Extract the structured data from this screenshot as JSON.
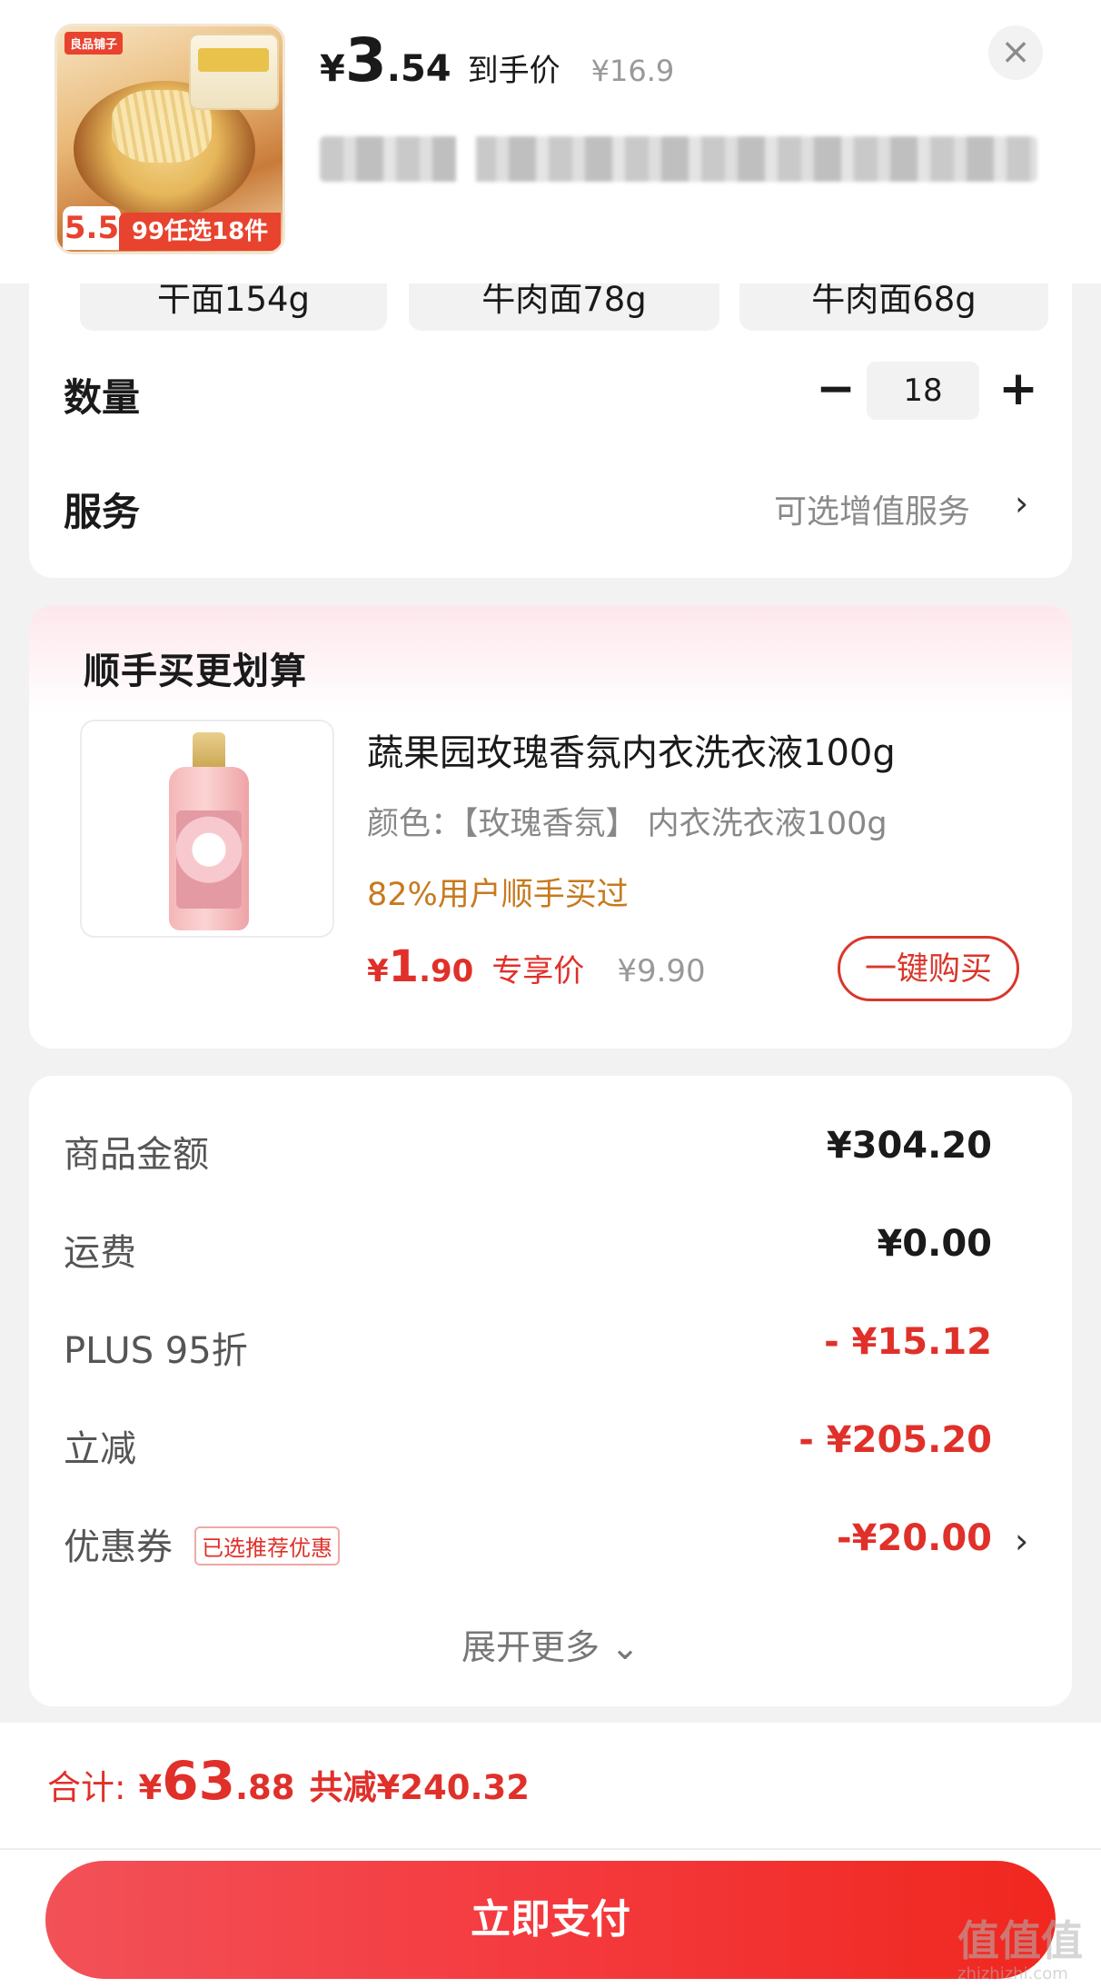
{
  "header": {
    "product_image": {
      "brand_logo": "良品铺子",
      "badge_number": "5.5",
      "promo_tag": "99任选18件"
    },
    "price": {
      "currency": "¥",
      "integer": "3",
      "decimal": ".54",
      "label": "到手价",
      "original": "¥16.9"
    }
  },
  "spec_options": [
    "干面154g",
    "牛肉面78g",
    "牛肉面68g"
  ],
  "quantity": {
    "label": "数量",
    "value": "18",
    "minus": "−",
    "plus": "+"
  },
  "service": {
    "label": "服务",
    "value": "可选增值服务",
    "chevron": "›"
  },
  "addon": {
    "section_title": "顺手买更划算",
    "name": "蔬果园玫瑰香氛内衣洗衣液100g",
    "spec": "颜色：【玫瑰香氛】 内衣洗衣液100g",
    "stat": "82%用户顺手买过",
    "price": {
      "currency": "¥",
      "integer": "1",
      "decimal": ".90",
      "label": "专享价",
      "original": "¥9.90"
    },
    "buy_button": "一键购买"
  },
  "summary": {
    "rows": [
      {
        "label": "商品金额",
        "value": "¥304.20"
      },
      {
        "label": "运费",
        "value": "¥0.00"
      },
      {
        "label": "PLUS 95折",
        "value": "- ¥15.12"
      },
      {
        "label": "立减",
        "value": "- ¥205.20"
      },
      {
        "label": "优惠券",
        "value": "-¥20.00"
      }
    ],
    "coupon_tag": "已选推荐优惠",
    "expand": "展开更多 ⌄"
  },
  "footer": {
    "total_label": "合计:",
    "currency": "¥",
    "total_integer": "63",
    "total_decimal": ".88",
    "saved": "共减¥240.32",
    "pay_button": "立即支付"
  },
  "watermark": {
    "text": "值值值",
    "sub": "zhizhizhi.com"
  },
  "colors": {
    "accent_red": "#e0302a",
    "pay_gradient_start": "#f25158",
    "pay_gradient_end": "#f0271f",
    "stat_orange": "#c77a1e"
  }
}
